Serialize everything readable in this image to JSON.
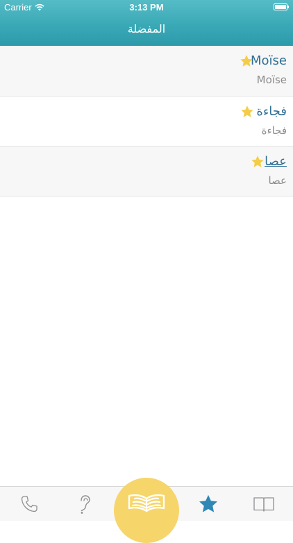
{
  "status_bar": {
    "carrier": "Carrier",
    "time": "3:13 PM"
  },
  "nav": {
    "title": "المفضلة"
  },
  "favorites": [
    {
      "title": "Moïse",
      "subtitle": "Moïse"
    },
    {
      "title": "فجاءة",
      "subtitle": "فجاءة"
    },
    {
      "title": "عصا",
      "subtitle": "عصا"
    }
  ],
  "tabs": [
    {
      "icon": "phone-icon"
    },
    {
      "icon": "ear-question-icon"
    },
    {
      "icon": "open-book-icon"
    },
    {
      "icon": "star-icon"
    },
    {
      "icon": "book-outline-icon"
    }
  ],
  "colors": {
    "header": "#3aa9b6",
    "star": "#f4cc4a",
    "active_tab": "#2f87b5",
    "title_text": "#2f6f95",
    "center_button": "#f6d56a"
  }
}
